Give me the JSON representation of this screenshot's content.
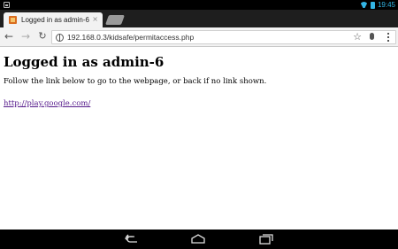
{
  "status_bar": {
    "time": "19:45",
    "icons": [
      "notification-icon",
      "wifi-icon",
      "battery-icon"
    ]
  },
  "tabs": [
    {
      "title": "Logged in as admin-6",
      "active": true,
      "close_glyph": "×"
    }
  ],
  "toolbar": {
    "url": "192.168.0.3/kidsafe/permitaccess.php"
  },
  "page": {
    "heading": "Logged in as admin-6",
    "instruction": "Follow the link below to go to the webpage, or back if no link shown.",
    "link": "http://play.google.com/"
  },
  "colors": {
    "status_accent": "#33b5e5",
    "visited_link": "#551a8b",
    "toolbar_bg": "#f2f2f2",
    "tabstrip_bg": "#1e1e1e"
  }
}
